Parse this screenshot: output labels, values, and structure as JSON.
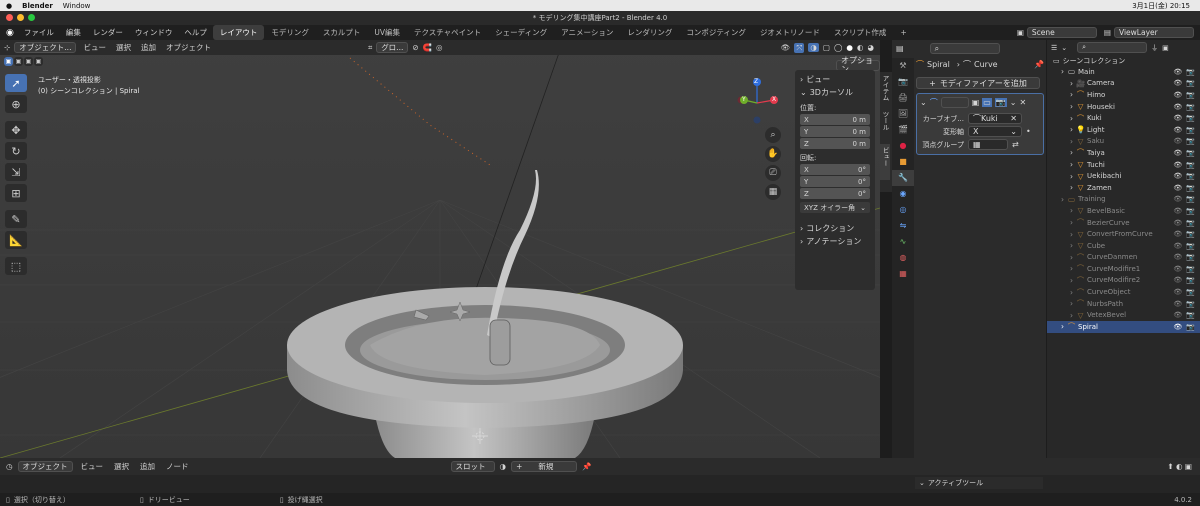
{
  "mac": {
    "app": "Blender",
    "window": "Window",
    "datetime": "3月1日(金)  20:15"
  },
  "title": "* モデリング集中講座Part2 - Blender 4.0",
  "menu": {
    "blender_icon": "blender-logo-icon",
    "items": [
      "ファイル",
      "編集",
      "レンダー",
      "ウィンドウ",
      "ヘルプ"
    ],
    "workspaces": [
      "レイアウト",
      "モデリング",
      "スカルプト",
      "UV編集",
      "テクスチャペイント",
      "シェーディング",
      "アニメーション",
      "レンダリング",
      "コンポジティング",
      "ジオメトリノード",
      "スクリプト作成"
    ],
    "active_workspace": "レイアウト",
    "add": "+",
    "scene": "Scene",
    "viewlayer": "ViewLayer"
  },
  "viewport": {
    "mode": "オブジェクト...",
    "menus": [
      "ビュー",
      "選択",
      "追加",
      "オブジェクト"
    ],
    "transform": "グロ...",
    "options": "オプション",
    "info_line1": "ユーザー・透視投影",
    "info_line2": "(0) シーンコレクション | Spiral",
    "gizmo": {
      "x": "X",
      "y": "Y",
      "z": "Z"
    }
  },
  "npanel": {
    "view": "ビュー",
    "cursor": "3Dカーソル",
    "location": "位置:",
    "rotation": "回転:",
    "loc": [
      {
        "a": "X",
        "v": "0 m"
      },
      {
        "a": "Y",
        "v": "0 m"
      },
      {
        "a": "Z",
        "v": "0 m"
      }
    ],
    "rot": [
      {
        "a": "X",
        "v": "0°"
      },
      {
        "a": "Y",
        "v": "0°"
      },
      {
        "a": "Z",
        "v": "0°"
      }
    ],
    "rot_mode": "XYZ オイラー角",
    "collection": "コレクション",
    "annotation": "アノテーション",
    "tabs": [
      "アイテム",
      "ツール",
      "ビュー"
    ]
  },
  "props": {
    "object": "Spiral",
    "modifier_target": "Curve",
    "add_modifier": "モディファイアーを追加",
    "curve_obj_label": "カーブオブ...",
    "curve_obj_value": "Kuki",
    "axis_label": "変形軸",
    "axis_value": "X",
    "vgroup_label": "頂点グループ"
  },
  "outliner": {
    "title": "シーンコレクション",
    "rows": [
      {
        "name": "Main",
        "indent": 1,
        "type": "collection",
        "dim": false
      },
      {
        "name": "Camera",
        "indent": 2,
        "type": "camera",
        "dim": false
      },
      {
        "name": "Himo",
        "indent": 2,
        "type": "curve",
        "dim": false
      },
      {
        "name": "Houseki",
        "indent": 2,
        "type": "mesh",
        "dim": false
      },
      {
        "name": "Kuki",
        "indent": 2,
        "type": "curve",
        "dim": false
      },
      {
        "name": "Light",
        "indent": 2,
        "type": "light",
        "dim": false
      },
      {
        "name": "Saku",
        "indent": 2,
        "type": "mesh",
        "dim": true
      },
      {
        "name": "Taiya",
        "indent": 2,
        "type": "curve",
        "dim": false
      },
      {
        "name": "Tuchi",
        "indent": 2,
        "type": "mesh",
        "dim": false
      },
      {
        "name": "Uekibachi",
        "indent": 2,
        "type": "mesh",
        "dim": false
      },
      {
        "name": "Zamen",
        "indent": 2,
        "type": "mesh",
        "dim": false
      },
      {
        "name": "Training",
        "indent": 1,
        "type": "collection",
        "dim": true
      },
      {
        "name": "BevelBasic",
        "indent": 2,
        "type": "mesh",
        "dim": true
      },
      {
        "name": "BezierCurve",
        "indent": 2,
        "type": "curve",
        "dim": true
      },
      {
        "name": "ConvertFromCurve",
        "indent": 2,
        "type": "mesh",
        "dim": true
      },
      {
        "name": "Cube",
        "indent": 2,
        "type": "mesh",
        "dim": true
      },
      {
        "name": "CurveDanmen",
        "indent": 2,
        "type": "curve",
        "dim": true
      },
      {
        "name": "CurveModifire1",
        "indent": 2,
        "type": "curve",
        "dim": true
      },
      {
        "name": "CurveModifire2",
        "indent": 2,
        "type": "curve",
        "dim": true
      },
      {
        "name": "CurveObject",
        "indent": 2,
        "type": "curve",
        "dim": true
      },
      {
        "name": "NurbsPath",
        "indent": 2,
        "type": "curve",
        "dim": true
      },
      {
        "name": "VetexBevel",
        "indent": 2,
        "type": "mesh",
        "dim": true
      },
      {
        "name": "Spiral",
        "indent": 1,
        "type": "curve",
        "dim": false,
        "selected": true
      }
    ]
  },
  "timeline": {
    "mode": "オブジェクト",
    "menus": [
      "ビュー",
      "選択",
      "追加",
      "ノード"
    ],
    "slot": "スロット",
    "new": "新規",
    "active_tool": "アクティブツール"
  },
  "status": {
    "select": "選択（切り替え）",
    "dolly": "ドリービュー",
    "lasso": "投げ縄選択",
    "version": "4.0.2"
  }
}
